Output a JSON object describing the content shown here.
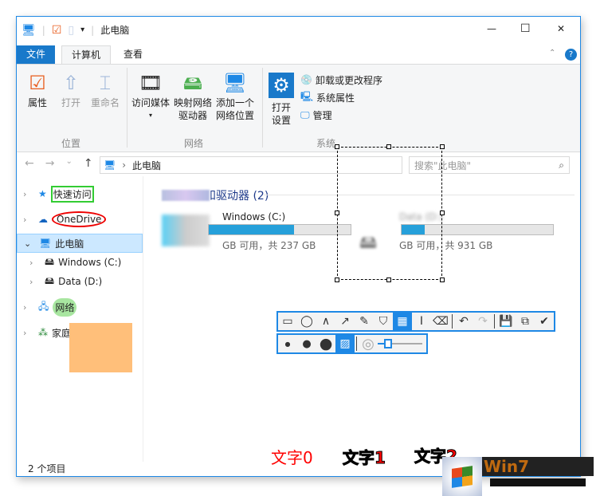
{
  "window": {
    "title": "此电脑",
    "min": "—",
    "max": "☐",
    "close": "✕"
  },
  "tabs": [
    {
      "label": "文件"
    },
    {
      "label": "计算机"
    },
    {
      "label": "查看"
    }
  ],
  "ribbon": {
    "location": {
      "label": "位置",
      "buttons": [
        "属性",
        "打开",
        "重命名"
      ]
    },
    "network": {
      "label": "网络",
      "buttons": [
        "访问媒体",
        "映射网络\n驱动器",
        "添加一个\n网络位置"
      ]
    },
    "system": {
      "label": "系统",
      "open_settings": "打开\n设置",
      "items": [
        "卸载或更改程序",
        "系统属性",
        "管理"
      ]
    }
  },
  "address": {
    "path": "此电脑",
    "search_placeholder": "搜索\"此电脑\""
  },
  "nav": {
    "items": [
      {
        "label": "快速访问"
      },
      {
        "label": "OneDrive"
      },
      {
        "label": "此电脑"
      },
      {
        "label": "Windows (C:)"
      },
      {
        "label": "Data (D:)"
      },
      {
        "label": "网络"
      },
      {
        "label": "家庭组"
      }
    ]
  },
  "content": {
    "section": "设备和驱动器 (2)",
    "drives": [
      {
        "name": "Windows (C:)",
        "free": "GB 可用，共 237 GB",
        "used_fraction": 0.6
      },
      {
        "name": "Data (D:)",
        "free": "GB 可用，共 931 GB",
        "used_fraction": 0.1
      }
    ]
  },
  "status": {
    "count": "2 个项目"
  },
  "annotations": {
    "text0": "文字0",
    "text1": "文字1",
    "text2": "文字2"
  },
  "logo": {
    "text": "Win7"
  }
}
